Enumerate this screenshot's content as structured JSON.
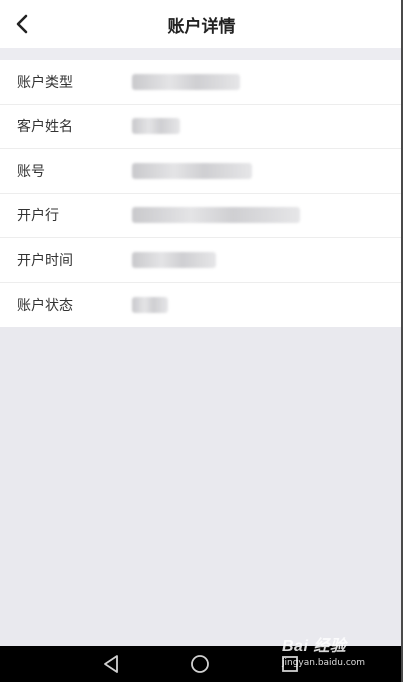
{
  "header": {
    "title": "账户详情",
    "back_icon": "chevron-left-icon"
  },
  "rows": [
    {
      "label": "账户类型"
    },
    {
      "label": "客户姓名"
    },
    {
      "label": "账号"
    },
    {
      "label": "开户行"
    },
    {
      "label": "开户时间"
    },
    {
      "label": "账户状态"
    }
  ],
  "navbar": {
    "icons": [
      "back-triangle-icon",
      "home-circle-icon",
      "recents-square-icon"
    ]
  },
  "watermark": {
    "brand": "Bai 经验",
    "site": "jingyan.baidu.com"
  },
  "colors": {
    "background": "#e9e9ee",
    "surface": "#ffffff",
    "navbar": "#000000"
  }
}
